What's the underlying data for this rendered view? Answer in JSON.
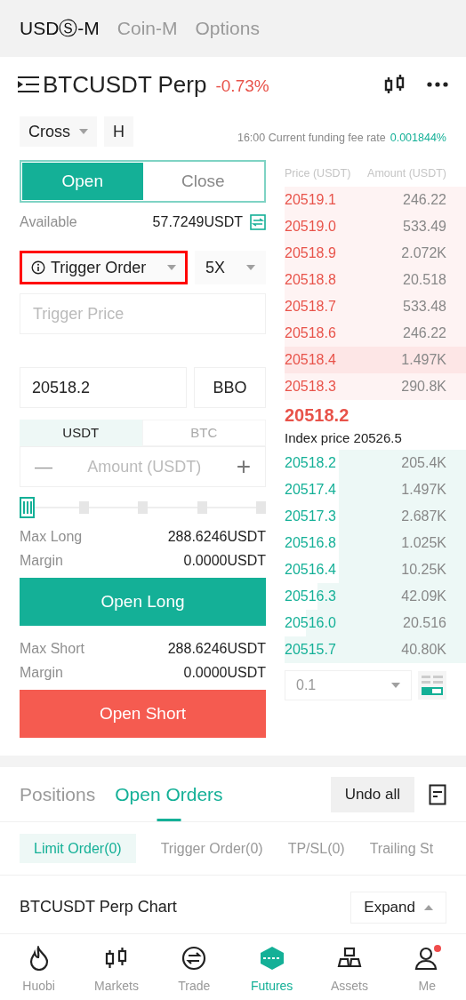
{
  "market_tabs": [
    {
      "label": "USDⓈ-M",
      "selected": true
    },
    {
      "label": "Coin-M",
      "selected": false
    },
    {
      "label": "Options",
      "selected": false
    }
  ],
  "header": {
    "symbol": "BTCUSDT Perp",
    "change": "-0.73%"
  },
  "margin_mode": "Cross",
  "position_mode": "H",
  "funding": {
    "label": "16:00 Current funding fee rate",
    "value": "0.001844%"
  },
  "side_tabs": [
    {
      "label": "Open",
      "selected": true
    },
    {
      "label": "Close",
      "selected": false
    }
  ],
  "available": {
    "label": "Available",
    "value": "57.7249USDT"
  },
  "order_type": {
    "label": "Trigger Order",
    "highlighted": true
  },
  "leverage": "5X",
  "trigger_price": {
    "placeholder": "Trigger Price"
  },
  "price": {
    "value": "20518.2",
    "bbo": "BBO"
  },
  "unit_tabs": [
    {
      "label": "USDT",
      "selected": true
    },
    {
      "label": "BTC",
      "selected": false
    }
  ],
  "amount": {
    "placeholder": "Amount (USDT)",
    "minus": "—",
    "plus": "+"
  },
  "long": {
    "max_label": "Max Long",
    "max_value": "288.6246USDT",
    "margin_label": "Margin",
    "margin_value": "0.0000USDT",
    "button": "Open Long"
  },
  "short": {
    "max_label": "Max Short",
    "max_value": "288.6246USDT",
    "margin_label": "Margin",
    "margin_value": "0.0000USDT",
    "button": "Open Short"
  },
  "order_book": {
    "price_header": "Price (USDT)",
    "amount_header": "Amount (USDT)",
    "asks": [
      {
        "price": "20519.1",
        "amount": "246.22"
      },
      {
        "price": "20519.0",
        "amount": "533.49"
      },
      {
        "price": "20518.9",
        "amount": "2.072K"
      },
      {
        "price": "20518.8",
        "amount": "20.518"
      },
      {
        "price": "20518.7",
        "amount": "533.48"
      },
      {
        "price": "20518.6",
        "amount": "246.22"
      },
      {
        "price": "20518.4",
        "amount": "1.497K"
      },
      {
        "price": "20518.3",
        "amount": "290.8K"
      }
    ],
    "last_price": "20518.2",
    "index_price": "Index price 20526.5",
    "bids": [
      {
        "price": "20518.2",
        "amount": "205.4K"
      },
      {
        "price": "20517.4",
        "amount": "1.497K"
      },
      {
        "price": "20517.3",
        "amount": "2.687K"
      },
      {
        "price": "20516.8",
        "amount": "1.025K"
      },
      {
        "price": "20516.4",
        "amount": "10.25K"
      },
      {
        "price": "20516.3",
        "amount": "42.09K"
      },
      {
        "price": "20516.0",
        "amount": "20.516"
      },
      {
        "price": "20515.7",
        "amount": "40.80K"
      }
    ],
    "precision": "0.1"
  },
  "orders_tabs": [
    {
      "label": "Positions",
      "selected": false
    },
    {
      "label": "Open Orders",
      "selected": true
    }
  ],
  "undo_all": "Undo all",
  "order_filters": [
    {
      "label": "Limit Order(0)",
      "selected": true
    },
    {
      "label": "Trigger Order(0)",
      "selected": false
    },
    {
      "label": "TP/SL(0)",
      "selected": false
    },
    {
      "label": "Trailing St",
      "selected": false
    }
  ],
  "chart_bar": {
    "title": "BTCUSDT Perp Chart",
    "expand": "Expand"
  },
  "nav": [
    {
      "label": "Huobi",
      "kind": "flame",
      "selected": false,
      "badge": false
    },
    {
      "label": "Markets",
      "kind": "candles",
      "selected": false,
      "badge": false
    },
    {
      "label": "Trade",
      "kind": "swap",
      "selected": false,
      "badge": false
    },
    {
      "label": "Futures",
      "kind": "futures",
      "selected": true,
      "badge": false
    },
    {
      "label": "Assets",
      "kind": "blocks",
      "selected": false,
      "badge": false
    },
    {
      "label": "Me",
      "kind": "person",
      "selected": false,
      "badge": true
    }
  ]
}
